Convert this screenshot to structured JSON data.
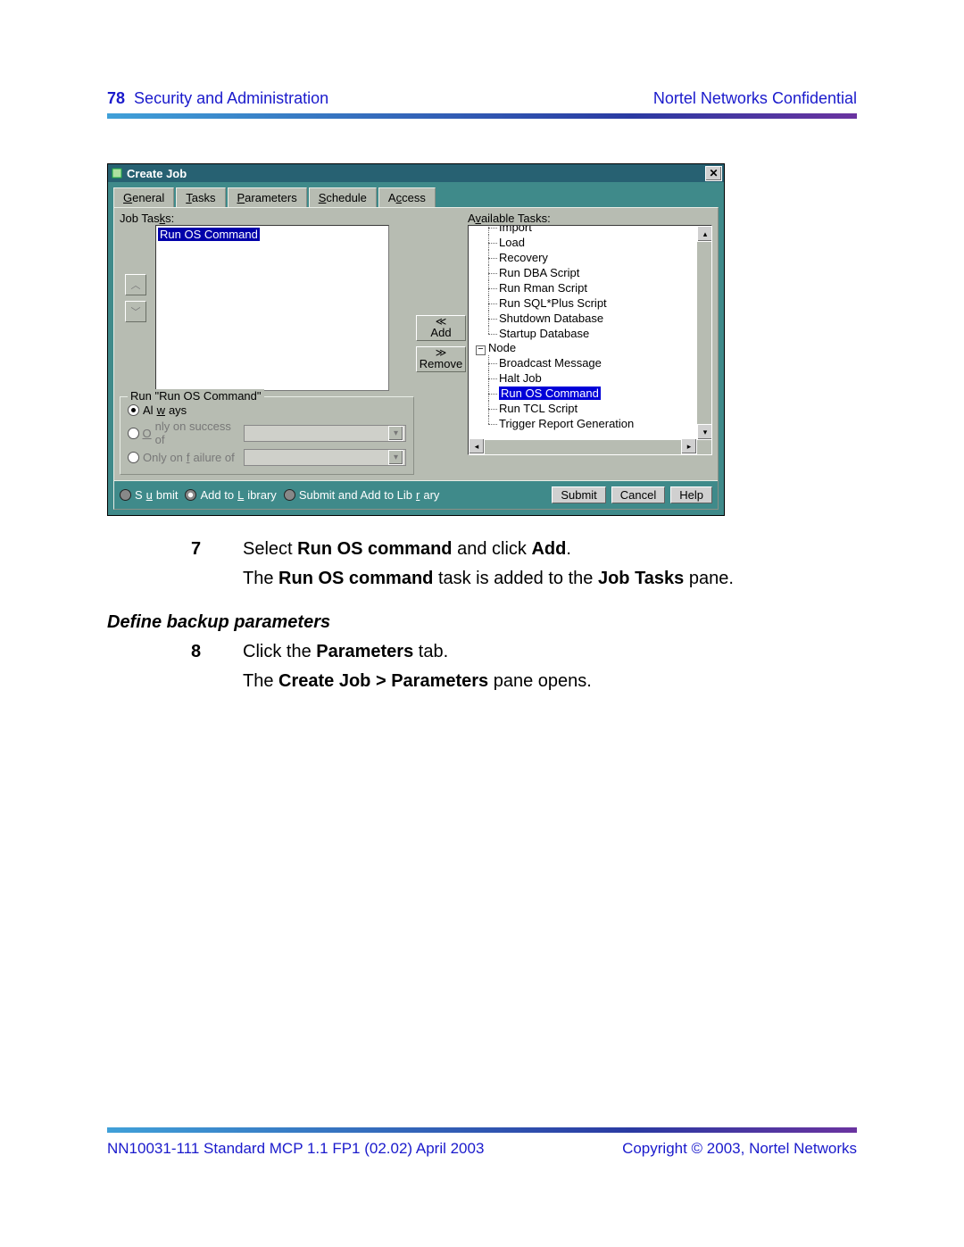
{
  "header": {
    "page": "78",
    "section": "Security and Administration",
    "conf": "Nortel Networks Confidential"
  },
  "window": {
    "title": "Create Job"
  },
  "tabs": [
    {
      "u": "G",
      "r": "eneral"
    },
    {
      "u": "T",
      "r": "asks"
    },
    {
      "u": "P",
      "r": "arameters"
    },
    {
      "u": "S",
      "r": "chedule"
    },
    {
      "l": "A",
      "u": "c",
      "r": "cess"
    }
  ],
  "labels": {
    "job_tasks_pre": "Job Tas",
    "job_tasks_u": "k",
    "job_tasks_post": "s:",
    "avail_pre": "A",
    "avail_u": "v",
    "avail_post": "ailable Tasks:"
  },
  "job_tasks": [
    "Run OS Command"
  ],
  "buttons": {
    "add": "Add",
    "remove": "Remove"
  },
  "tree": [
    "Import",
    "Load",
    "Recovery",
    "Run DBA Script",
    "Run Rman Script",
    "Run SQL*Plus Script",
    "Shutdown Database",
    "Startup Database"
  ],
  "tree_node": "Node",
  "tree_n": [
    "Broadcast Message",
    "Halt Job",
    "Run OS Command",
    "Run TCL Script",
    "Trigger Report Generation"
  ],
  "group": {
    "caption": "Run \"Run OS Command\"",
    "always_pre": "Al",
    "always_u": "w",
    "always_post": "ays",
    "success_u": "O",
    "success_r": "nly on success of",
    "failure_l": "Only on ",
    "failure_u": "f",
    "failure_r": "ailure of"
  },
  "footer": {
    "opts": [
      {
        "pre": "S",
        "u": "u",
        "post": "bmit"
      },
      {
        "pre": "Add to ",
        "u": "L",
        "post": "ibrary"
      },
      {
        "pre": "Submit and Add to Lib",
        "u": "r",
        "post": "ary"
      }
    ],
    "submit": "Submit",
    "cancel": "Cancel",
    "help": "Help"
  },
  "doc": {
    "step7": {
      "num": "7",
      "t1": "Select ",
      "b1": "Run OS command",
      "t2": " and click ",
      "b2": "Add",
      "t3": "."
    },
    "step7b": {
      "t1": "The ",
      "b1": "Run OS command",
      "t2": " task is added to the ",
      "b2": "Job Tasks",
      "t3": " pane."
    },
    "subhead": "Define backup parameters",
    "step8": {
      "num": "8",
      "t1": "Click the ",
      "b1": "Parameters",
      "t2": " tab."
    },
    "step8b": {
      "t1": "The ",
      "b1": "Create Job > Parameters",
      "t2": " pane opens."
    }
  },
  "pgfoot": {
    "left": "NN10031-111   Standard   MCP 1.1 FP1 (02.02)   April 2003",
    "right": "Copyright © 2003, Nortel Networks"
  }
}
